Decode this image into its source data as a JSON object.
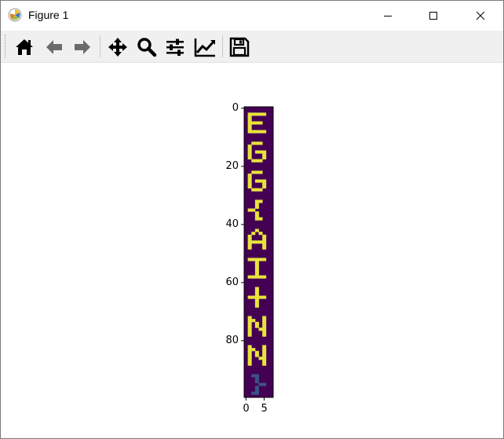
{
  "window": {
    "title": "Figure 1",
    "app_icon": "matplotlib-icon"
  },
  "title_buttons": [
    "minimize-icon",
    "maximize-icon",
    "close-icon"
  ],
  "toolbar": {
    "buttons": [
      "home-icon",
      "back-arrow-icon",
      "forward-arrow-icon",
      "pan-move-icon",
      "zoom-magnifier-icon",
      "subplots-config-icon",
      "axes-edit-icon",
      "save-floppy-icon"
    ]
  },
  "chart_data": {
    "type": "heatmap",
    "title": "",
    "xlabel": "",
    "ylabel": "",
    "y_ticks": [
      "0",
      "20",
      "40",
      "60",
      "80"
    ],
    "x_ticks": [
      "0",
      "5"
    ],
    "shape": [
      100,
      8
    ],
    "colors": {
      "background": "#440154",
      "foreground": "#e8e33c",
      "dim": "#3b528b"
    },
    "text_rendered": "EGG{AI+NN}",
    "glyphs": [
      {
        "char": "E",
        "y": 2,
        "rows": [
          "11111",
          "10000",
          "10000",
          "11110",
          "10000",
          "10000",
          "11111"
        ]
      },
      {
        "char": "G",
        "y": 12,
        "rows": [
          "01110",
          "10000",
          "10000",
          "10111",
          "10001",
          "10001",
          "01110"
        ]
      },
      {
        "char": "G",
        "y": 22,
        "rows": [
          "01110",
          "10000",
          "10000",
          "10111",
          "10001",
          "10001",
          "01110"
        ]
      },
      {
        "char": "{",
        "y": 32,
        "rows": [
          "00110",
          "00100",
          "00100",
          "11000",
          "00100",
          "00100",
          "00110"
        ]
      },
      {
        "char": "A",
        "y": 42,
        "rows": [
          "00100",
          "01010",
          "10001",
          "10001",
          "11111",
          "10001",
          "10001"
        ]
      },
      {
        "char": "I",
        "y": 52,
        "rows": [
          "11111",
          "00100",
          "00100",
          "00100",
          "00100",
          "00100",
          "11111"
        ]
      },
      {
        "char": "+",
        "y": 62,
        "rows": [
          "00100",
          "00100",
          "00100",
          "11111",
          "00100",
          "00100",
          "00100"
        ]
      },
      {
        "char": "N",
        "y": 72,
        "rows": [
          "10001",
          "11001",
          "10101",
          "10101",
          "10011",
          "10001",
          "10001"
        ]
      },
      {
        "char": "N",
        "y": 82,
        "rows": [
          "10001",
          "11001",
          "10101",
          "10101",
          "10011",
          "10001",
          "10001"
        ]
      },
      {
        "char": "}",
        "y": 92,
        "rows": [
          "01100",
          "00100",
          "00100",
          "00011",
          "00100",
          "00100",
          "01100"
        ]
      }
    ]
  }
}
